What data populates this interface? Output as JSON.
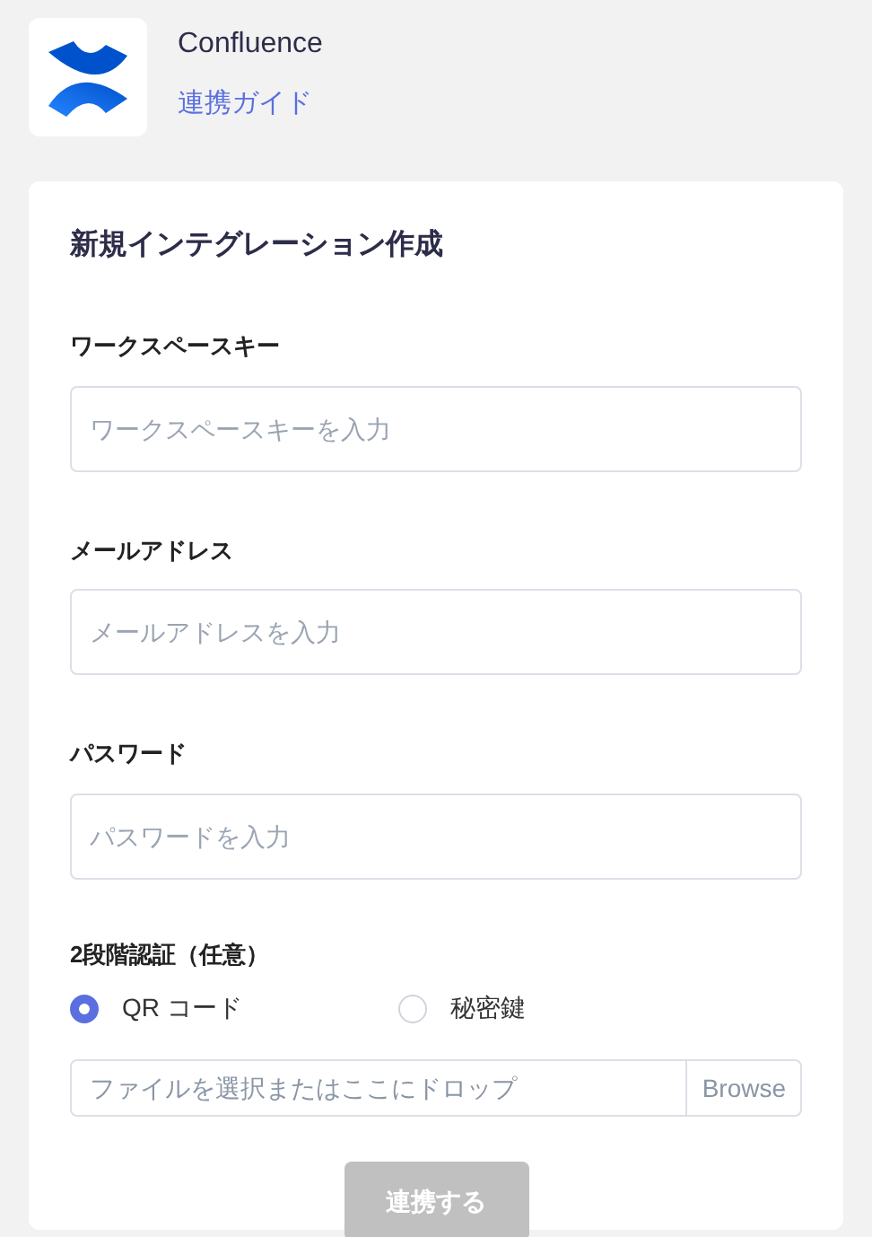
{
  "app": {
    "name": "Confluence",
    "guide_link": "連携ガイド"
  },
  "form": {
    "title": "新規インテグレーション作成",
    "fields": [
      {
        "label": "ワークスペースキー",
        "placeholder": "ワークスペースキーを入力"
      },
      {
        "label": "メールアドレス",
        "placeholder": "メールアドレスを入力"
      },
      {
        "label": "パスワード",
        "placeholder": "パスワードを入力"
      }
    ],
    "two_factor": {
      "label": "2段階認証（任意）",
      "options": [
        {
          "label": "QR コード",
          "selected": true
        },
        {
          "label": "秘密鍵",
          "selected": false
        }
      ]
    },
    "file_input": {
      "placeholder": "ファイルを選択またはここにドロップ",
      "browse": "Browse"
    },
    "submit": {
      "label": "連携する",
      "disabled": true
    }
  }
}
